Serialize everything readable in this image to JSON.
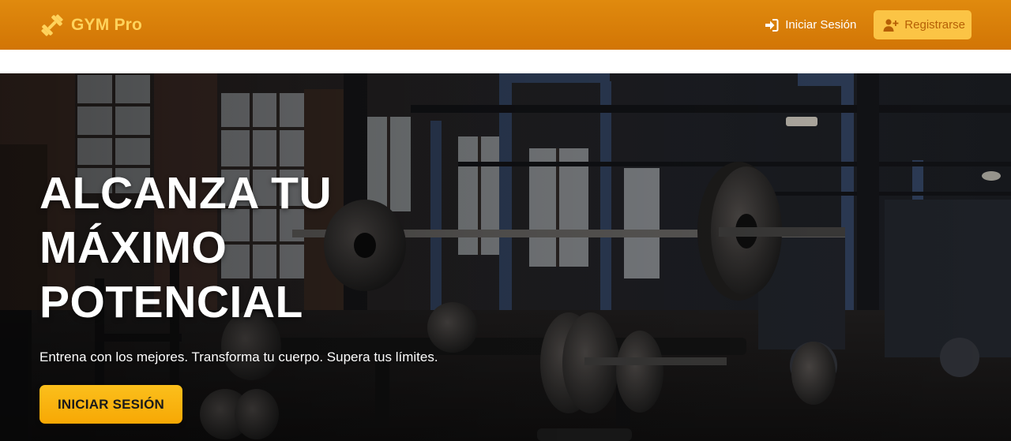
{
  "navbar": {
    "brand": "GYM Pro",
    "brand_icon": "dumbbell-icon",
    "login_label": "Iniciar Sesión",
    "login_icon": "sign-in-icon",
    "register_label": "Registrarse",
    "register_icon": "user-plus-icon"
  },
  "hero": {
    "title_line1": "ALCANZA TU",
    "title_line2": "MÁXIMO",
    "title_line3": "POTENCIAL",
    "subtitle": "Entrena con los mejores. Transforma tu cuerpo. Supera tus límites.",
    "cta_label": "INICIAR SESIÓN",
    "background_image": "gym-barbell-photo"
  },
  "colors": {
    "navbar": "#d97f08",
    "brand_text": "#ffd35c",
    "register_button": "#fbc445",
    "cta_button": "#f9b20c"
  }
}
